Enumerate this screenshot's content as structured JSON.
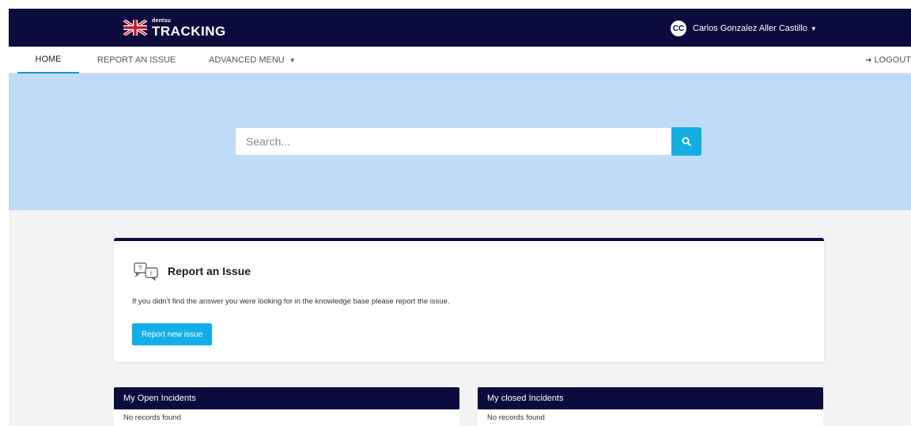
{
  "header": {
    "brand_small": "dentsu",
    "brand_big": "TRACKING",
    "user_initials": "CC",
    "user_name": "Carlos Gonzalez Aller Castillo"
  },
  "nav": {
    "home": "HOME",
    "report": "REPORT AN ISSUE",
    "advanced": "ADVANCED MENU",
    "logout": "LOGOUT"
  },
  "search": {
    "placeholder": "Search..."
  },
  "report_card": {
    "title": "Report an Issue",
    "description": "If you didn't find the answer you were looking for in the knowledge base please report the issue.",
    "button": "Report new issue"
  },
  "panels": {
    "open_title": "My Open Incidents",
    "open_empty": "No records found",
    "closed_title": "My closed Incidents",
    "closed_empty": "No records found"
  },
  "colors": {
    "navy": "#0b0b3d",
    "accent": "#15aee3",
    "hero_bg": "#c0dbf8",
    "content_bg": "#f3f3f3"
  }
}
